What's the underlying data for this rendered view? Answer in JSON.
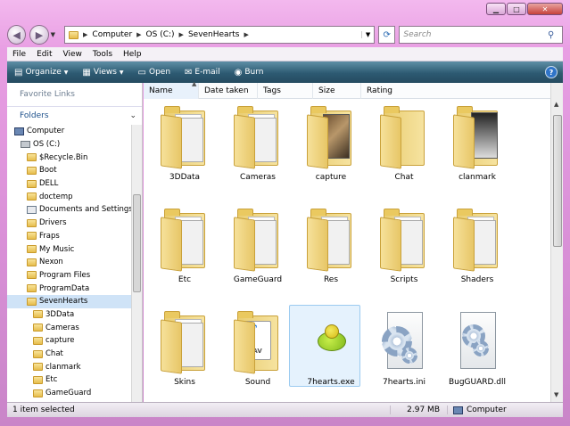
{
  "window": {
    "minimize": "▁",
    "maximize": "□",
    "close": "✕"
  },
  "address": {
    "crumbs": [
      "Computer",
      "OS (C:)",
      "SevenHearts"
    ],
    "search_placeholder": "Search"
  },
  "menu": [
    "File",
    "Edit",
    "View",
    "Tools",
    "Help"
  ],
  "toolbar": {
    "organize": "Organize",
    "views": "Views",
    "open": "Open",
    "email": "E-mail",
    "burn": "Burn",
    "help": "?"
  },
  "navpane": {
    "favorite_links": "Favorite Links",
    "folders": "Folders",
    "tree": [
      {
        "label": "Computer",
        "kind": "pc",
        "indent": 0
      },
      {
        "label": "OS (C:)",
        "kind": "drive",
        "indent": 1
      },
      {
        "label": "$Recycle.Bin",
        "kind": "folder",
        "indent": 2
      },
      {
        "label": "Boot",
        "kind": "folder",
        "indent": 2
      },
      {
        "label": "DELL",
        "kind": "folder",
        "indent": 2
      },
      {
        "label": "doctemp",
        "kind": "folder",
        "indent": 2
      },
      {
        "label": "Documents and Settings",
        "kind": "doc",
        "indent": 2
      },
      {
        "label": "Drivers",
        "kind": "folder",
        "indent": 2
      },
      {
        "label": "Fraps",
        "kind": "folder",
        "indent": 2
      },
      {
        "label": "My Music",
        "kind": "folder",
        "indent": 2
      },
      {
        "label": "Nexon",
        "kind": "folder",
        "indent": 2
      },
      {
        "label": "Program Files",
        "kind": "folder",
        "indent": 2
      },
      {
        "label": "ProgramData",
        "kind": "folder",
        "indent": 2
      },
      {
        "label": "SevenHearts",
        "kind": "folder",
        "indent": 2,
        "selected": true
      },
      {
        "label": "3DData",
        "kind": "folder",
        "indent": 3
      },
      {
        "label": "Cameras",
        "kind": "folder",
        "indent": 3
      },
      {
        "label": "capture",
        "kind": "folder",
        "indent": 3
      },
      {
        "label": "Chat",
        "kind": "folder",
        "indent": 3
      },
      {
        "label": "clanmark",
        "kind": "folder",
        "indent": 3
      },
      {
        "label": "Etc",
        "kind": "folder",
        "indent": 3
      },
      {
        "label": "GameGuard",
        "kind": "folder",
        "indent": 3
      }
    ]
  },
  "columns": [
    "Name",
    "Date taken",
    "Tags",
    "Size",
    "Rating"
  ],
  "items": [
    {
      "label": "3DData",
      "kind": "folder"
    },
    {
      "label": "Cameras",
      "kind": "folder-paper"
    },
    {
      "label": "capture",
      "kind": "folder-photo"
    },
    {
      "label": "Chat",
      "kind": "folder-empty"
    },
    {
      "label": "clanmark",
      "kind": "folder-photo2"
    },
    {
      "label": "Etc",
      "kind": "folder"
    },
    {
      "label": "GameGuard",
      "kind": "folder-paper"
    },
    {
      "label": "Res",
      "kind": "folder-paper"
    },
    {
      "label": "Scripts",
      "kind": "folder"
    },
    {
      "label": "Shaders",
      "kind": "folder"
    },
    {
      "label": "Skins",
      "kind": "folder"
    },
    {
      "label": "Sound",
      "kind": "folder-wav"
    },
    {
      "label": "7hearts.exe",
      "kind": "exe",
      "selected": true
    },
    {
      "label": "7hearts.ini",
      "kind": "ini"
    },
    {
      "label": "BugGUARD.dll",
      "kind": "dll"
    }
  ],
  "status": {
    "selection": "1 item selected",
    "size": "2.97 MB",
    "location": "Computer"
  }
}
